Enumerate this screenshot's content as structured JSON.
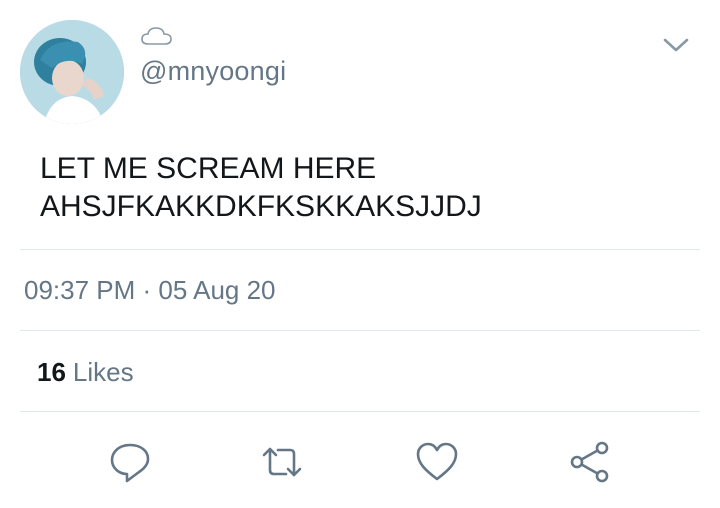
{
  "tweet": {
    "display_name_icon": "cloud-emoji-icon",
    "handle": "@mnyoongi",
    "text_lines": [
      "LET ME SCREAM HERE",
      "AHSJFKAKKDKFKSKKAKSJJDJ"
    ],
    "timestamp": "09:37 PM · 05 Aug 20",
    "likes_count": "16",
    "likes_label": "Likes"
  },
  "icons": {
    "menu": "chevron-down-icon",
    "reply": "reply-icon",
    "retweet": "retweet-icon",
    "like": "heart-icon",
    "share": "share-icon"
  },
  "colors": {
    "text": "#14171a",
    "secondary": "#657786",
    "divider": "#e1e8ed"
  }
}
